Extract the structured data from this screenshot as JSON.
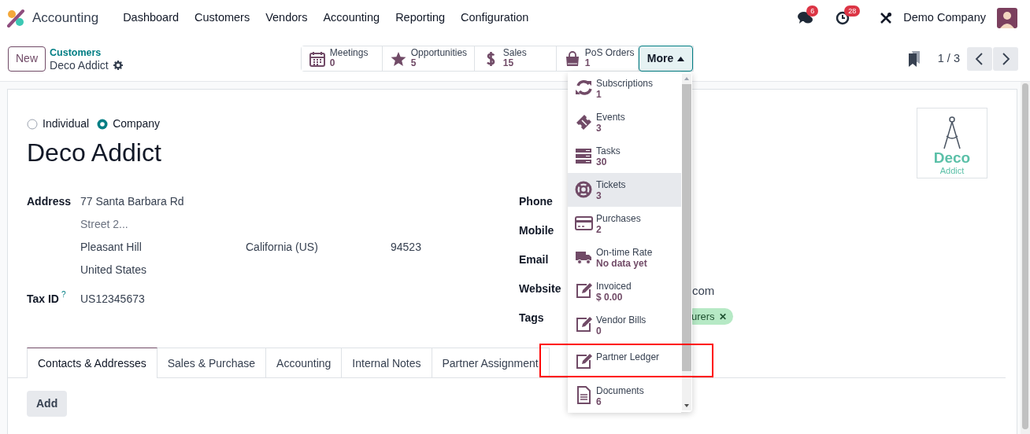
{
  "navbar": {
    "app_name": "Accounting",
    "menu": [
      "Dashboard",
      "Customers",
      "Vendors",
      "Accounting",
      "Reporting",
      "Configuration"
    ],
    "messages_count": "6",
    "activities_count": "28",
    "company": "Demo Company"
  },
  "control_panel": {
    "new_button": "New",
    "breadcrumb": "Customers",
    "record_name": "Deco Addict",
    "pager": "1 / 3",
    "smart_buttons": [
      {
        "label": "Meetings",
        "value": "0"
      },
      {
        "label": "Opportunities",
        "value": "5"
      },
      {
        "label": "Sales",
        "value": "15"
      },
      {
        "label": "PoS Orders",
        "value": "1"
      }
    ],
    "more_button": {
      "label": "More",
      "expanded": true
    }
  },
  "more_menu": [
    {
      "label": "Subscriptions",
      "value": "1",
      "selected": false,
      "outlined": false
    },
    {
      "label": "Events",
      "value": "3",
      "selected": false,
      "outlined": false
    },
    {
      "label": "Tasks",
      "value": "30",
      "selected": false,
      "outlined": false
    },
    {
      "label": "Tickets",
      "value": "3",
      "selected": true,
      "outlined": false
    },
    {
      "label": "Purchases",
      "value": "2",
      "selected": false,
      "outlined": false
    },
    {
      "label": "On-time Rate",
      "value": "No data yet",
      "selected": false,
      "outlined": false
    },
    {
      "label": "Invoiced",
      "value": "$ 0.00",
      "selected": false,
      "outlined": false
    },
    {
      "label": "Vendor Bills",
      "value": "0",
      "selected": false,
      "outlined": false
    },
    {
      "label": "Partner Ledger",
      "selected": false,
      "outlined": true
    },
    {
      "label": "Documents",
      "value": "6",
      "selected": false,
      "outlined": false
    }
  ],
  "form": {
    "company_type": [
      {
        "label": "Individual",
        "selected": false
      },
      {
        "label": "Company",
        "selected": true
      }
    ],
    "name": "Deco Addict",
    "logo_text": [
      "Deco",
      "Addict"
    ],
    "address_label": "Address",
    "street": "77 Santa Barbara Rd",
    "street2_placeholder": "Street 2...",
    "city": "Pleasant Hill",
    "state": "California (US)",
    "zip": "94523",
    "country": "United States",
    "tax_id_label": "Tax ID",
    "tax_id_help": "?",
    "tax_id": "US12345673",
    "right_fields": [
      {
        "label": "Phone"
      },
      {
        "label": "Mobile"
      },
      {
        "label": "Email"
      },
      {
        "label": "Website",
        "value": "com"
      },
      {
        "label": "Tags",
        "tag": "urers",
        "tag_remove": "✕"
      }
    ]
  },
  "tabs": [
    {
      "label": "Contacts & Addresses",
      "selected": true
    },
    {
      "label": "Sales & Purchase",
      "selected": false
    },
    {
      "label": "Accounting",
      "selected": false
    },
    {
      "label": "Internal Notes",
      "selected": false
    },
    {
      "label": "Partner Assignment",
      "selected": false
    }
  ],
  "add_button": "Add"
}
